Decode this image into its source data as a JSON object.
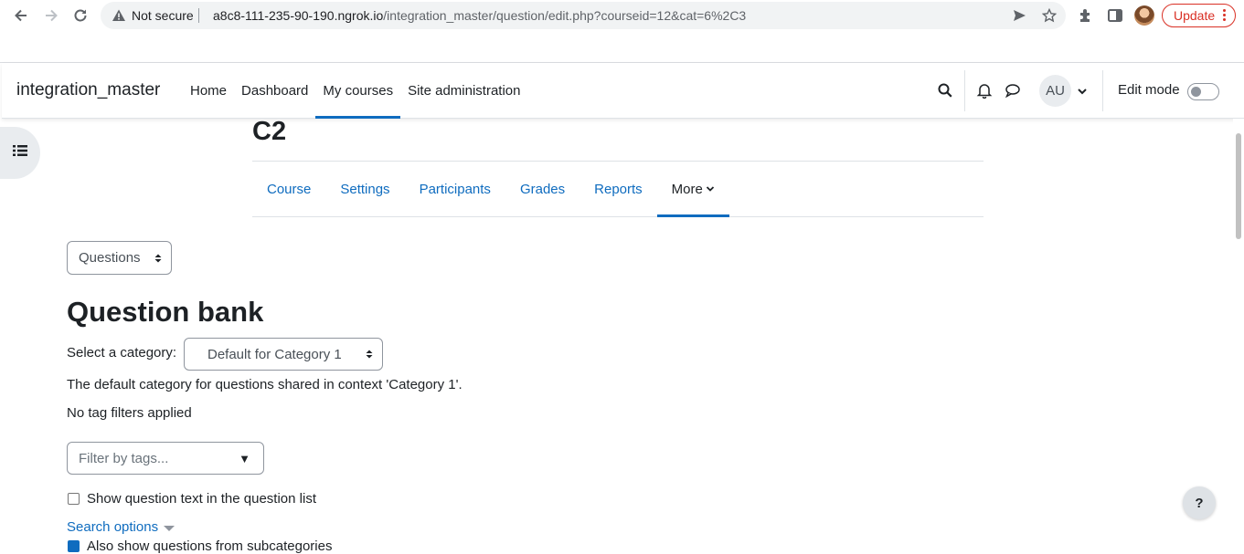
{
  "browser": {
    "security_label": "Not secure",
    "url_host": "a8c8-111-235-90-190.ngrok.io",
    "url_path": "/integration_master/question/edit.php?courseid=12&cat=6%2C3",
    "update_label": "Update"
  },
  "navbar": {
    "brand": "integration_master",
    "items": [
      {
        "label": "Home"
      },
      {
        "label": "Dashboard"
      },
      {
        "label": "My courses"
      },
      {
        "label": "Site administration"
      }
    ],
    "avatar_initials": "AU",
    "edit_mode_label": "Edit mode"
  },
  "course": {
    "title": "C2",
    "tabs": [
      {
        "label": "Course"
      },
      {
        "label": "Settings"
      },
      {
        "label": "Participants"
      },
      {
        "label": "Grades"
      },
      {
        "label": "Reports"
      },
      {
        "label": "More"
      }
    ]
  },
  "content": {
    "page_select_value": "Questions",
    "heading": "Question bank",
    "category_label": "Select a category:",
    "category_value": "Default for Category 1",
    "category_description": "The default category for questions shared in context 'Category 1'.",
    "tag_status": "No tag filters applied",
    "tag_filter_placeholder": "Filter by tags...",
    "show_text_label": "Show question text in the question list",
    "search_options_label": "Search options",
    "subcategories_label": "Also show questions from subcategories"
  },
  "help_label": "?"
}
